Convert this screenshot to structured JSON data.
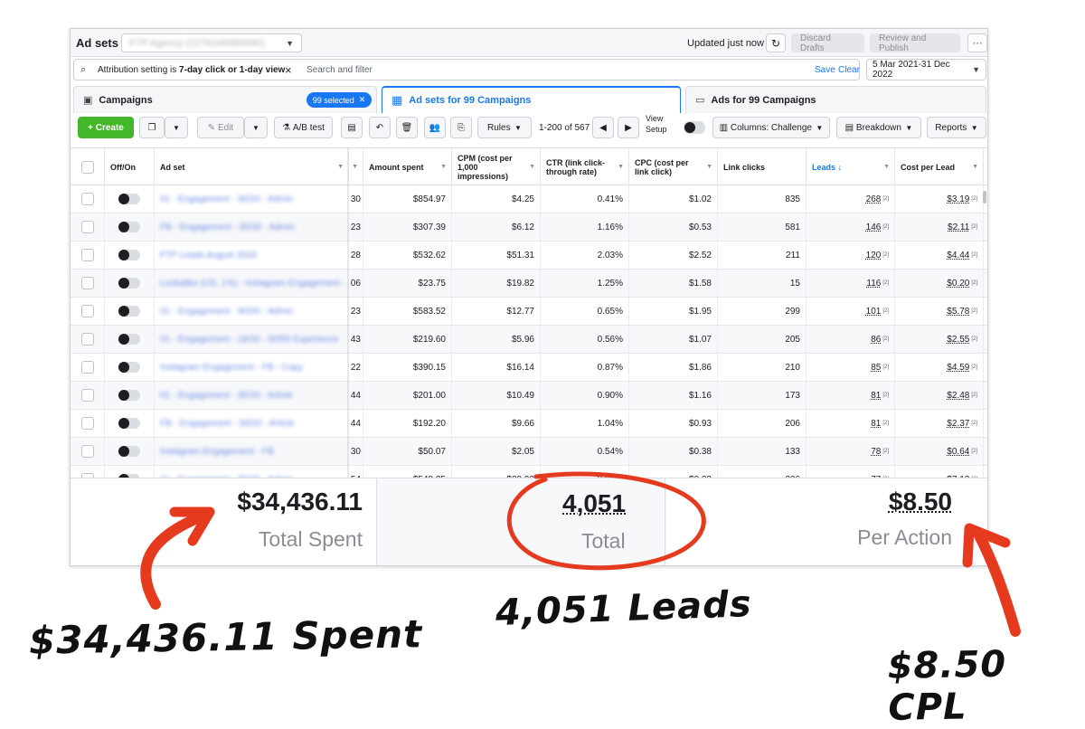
{
  "topbar": {
    "title": "Ad sets",
    "account": "FTP Agency (2276346989090)",
    "updated": "Updated just now",
    "discard": "Discard Drafts",
    "review": "Review and Publish",
    "more": "···"
  },
  "filterbar": {
    "chip_prefix": "Attribution setting is ",
    "chip_value": "7-day click or 1-day view",
    "search_placeholder": "Search and filter",
    "save": "Save",
    "clear": "Clear",
    "date_range": "5 Mar 2021-31 Dec 2022"
  },
  "tabs": {
    "campaigns": "Campaigns",
    "selected": "99 selected",
    "adsets": "Ad sets for 99 Campaigns",
    "ads": "Ads for 99 Campaigns"
  },
  "toolbar": {
    "create": "Create",
    "edit": "Edit",
    "abtest": "A/B test",
    "rules": "Rules",
    "page": "1-200 of 567",
    "view_setup": "View Setup",
    "columns": "Columns: Challenge",
    "breakdown": "Breakdown",
    "reports": "Reports"
  },
  "columns": {
    "offon": "Off/On",
    "adset": "Ad set",
    "amount": "Amount spent",
    "cpm": "CPM (cost per 1,000 impressions)",
    "ctr": "CTR (link click-through rate)",
    "cpc": "CPC (cost per link click)",
    "clicks": "Link clicks",
    "leads": "Leads ↓",
    "cpl": "Cost per Lead"
  },
  "rows": [
    {
      "name": "01 - Engagement - 30/20 - Admin",
      "cut": "30",
      "amount": "$854.97",
      "cpm": "$4.25",
      "ctr": "0.41%",
      "cpc": "$1.02",
      "clicks": "835",
      "leads": "268",
      "cpl": "$3.19"
    },
    {
      "name": "FB - Engagement - 30/30 - Admin",
      "cut": "23",
      "amount": "$307.39",
      "cpm": "$6.12",
      "ctr": "1.16%",
      "cpc": "$0.53",
      "clicks": "581",
      "leads": "146",
      "cpl": "$2.11"
    },
    {
      "name": "FTP Leads August 2020",
      "cut": "28",
      "amount": "$532.62",
      "cpm": "$51.31",
      "ctr": "2.03%",
      "cpc": "$2.52",
      "clicks": "211",
      "leads": "120",
      "cpl": "$4.44"
    },
    {
      "name": "Lookalike (US, 1%) - Instagram Engagement - ...",
      "cut": "06",
      "amount": "$23.75",
      "cpm": "$19.82",
      "ctr": "1.25%",
      "cpc": "$1.58",
      "clicks": "15",
      "leads": "116",
      "cpl": "$0.20"
    },
    {
      "name": "01 - Engagement - 30/20 - Admin",
      "cut": "23",
      "amount": "$583.52",
      "cpm": "$12.77",
      "ctr": "0.65%",
      "cpc": "$1.95",
      "clicks": "299",
      "leads": "101",
      "cpl": "$5.78"
    },
    {
      "name": "01 - Engagement - 18/20 - 50/50 Experience",
      "cut": "43",
      "amount": "$219.60",
      "cpm": "$5.96",
      "ctr": "0.56%",
      "cpc": "$1.07",
      "clicks": "205",
      "leads": "86",
      "cpl": "$2.55"
    },
    {
      "name": "Instagram Engagement - FB - Copy",
      "cut": "22",
      "amount": "$390.15",
      "cpm": "$16.14",
      "ctr": "0.87%",
      "cpc": "$1.86",
      "clicks": "210",
      "leads": "85",
      "cpl": "$4.59"
    },
    {
      "name": "01 - Engagement - 30/20 - Article",
      "cut": "44",
      "amount": "$201.00",
      "cpm": "$10.49",
      "ctr": "0.90%",
      "cpc": "$1.16",
      "clicks": "173",
      "leads": "81",
      "cpl": "$2.48"
    },
    {
      "name": "FB - Engagement - 30/20 - Article",
      "cut": "44",
      "amount": "$192.20",
      "cpm": "$9.66",
      "ctr": "1.04%",
      "cpc": "$0.93",
      "clicks": "206",
      "leads": "81",
      "cpl": "$2.37"
    },
    {
      "name": "Instagram Engagement - FB",
      "cut": "30",
      "amount": "$50.07",
      "cpm": "$2.05",
      "ctr": "0.54%",
      "cpc": "$0.38",
      "clicks": "133",
      "leads": "78",
      "cpl": "$0.64"
    },
    {
      "name": "01 - Engagement - 30/20 - Admin",
      "cut": "54",
      "amount": "$548.35",
      "cpm": "$20.92",
      "ctr": "0.90%",
      "cpc": "$2.32",
      "clicks": "236",
      "leads": "77",
      "cpl": "$7.12"
    }
  ],
  "footnote": "[2]",
  "summary": {
    "spent": "$34,436.11",
    "spent_label": "Total Spent",
    "total": "4,051",
    "total_label": "Total",
    "cpl": "$8.50",
    "cpl_label": "Per Action"
  },
  "annotations": {
    "spent": "$34,436.11 Spent",
    "leads": "4,051 Leads",
    "cpl": "$8.50 CPL",
    "color": "#e63a1e"
  }
}
